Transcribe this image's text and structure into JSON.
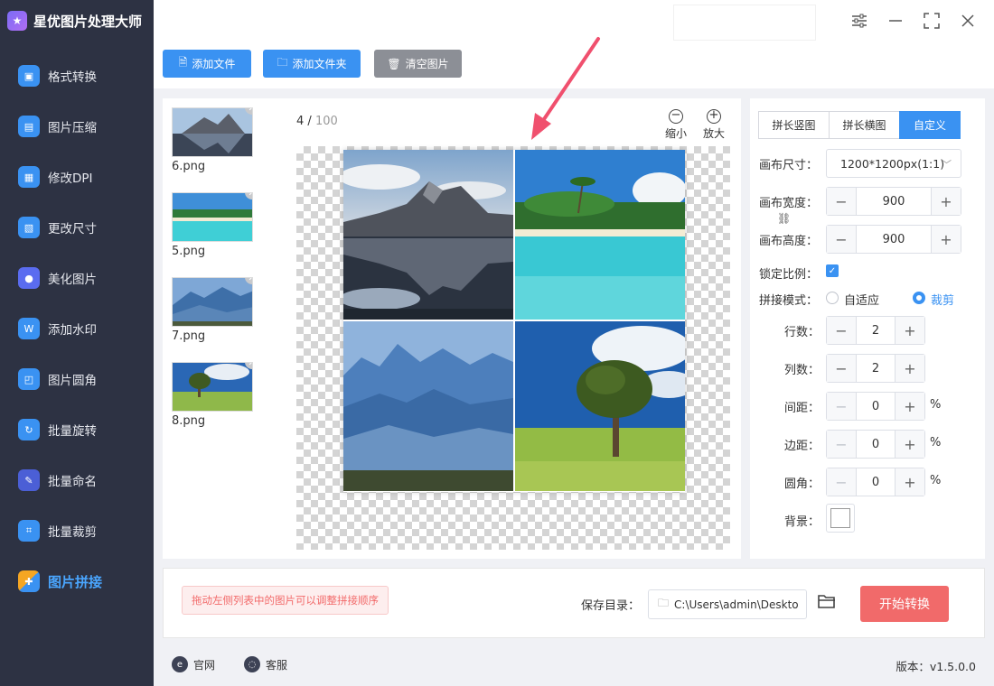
{
  "app": {
    "title": "星优图片处理大师",
    "logo_text": "★"
  },
  "sidebar": {
    "items": [
      {
        "label": "格式转换",
        "icon": "image-convert-icon",
        "color": "#3a92f2"
      },
      {
        "label": "图片压缩",
        "icon": "image-compress-icon",
        "color": "#3a92f2"
      },
      {
        "label": "修改DPI",
        "icon": "dpi-icon",
        "color": "#3a92f2"
      },
      {
        "label": "更改尺寸",
        "icon": "resize-icon",
        "color": "#3a92f2"
      },
      {
        "label": "美化图片",
        "icon": "beautify-icon",
        "color": "#5a6cf0"
      },
      {
        "label": "添加水印",
        "icon": "watermark-icon",
        "color": "#3a92f2"
      },
      {
        "label": "图片圆角",
        "icon": "round-corner-icon",
        "color": "#3a92f2"
      },
      {
        "label": "批量旋转",
        "icon": "rotate-icon",
        "color": "#3a92f2"
      },
      {
        "label": "批量命名",
        "icon": "rename-icon",
        "color": "#4b5fd6"
      },
      {
        "label": "批量裁剪",
        "icon": "crop-icon",
        "color": "#3a92f2"
      },
      {
        "label": "图片拼接",
        "icon": "puzzle-icon",
        "color": "#f5a623"
      }
    ],
    "active_index": 10
  },
  "toolbar": {
    "add_file": "添加文件",
    "add_folder": "添加文件夹",
    "clear": "清空图片"
  },
  "files": [
    {
      "name": "6.png",
      "scene": "lake"
    },
    {
      "name": "5.png",
      "scene": "beach"
    },
    {
      "name": "7.png",
      "scene": "mountains"
    },
    {
      "name": "8.png",
      "scene": "tree"
    }
  ],
  "preview": {
    "count": "4",
    "separator": " / ",
    "total": "100",
    "zoom_out": "缩小",
    "zoom_in": "放大"
  },
  "settings": {
    "tabs": [
      "拼长竖图",
      "拼长横图",
      "自定义"
    ],
    "active_tab": 2,
    "canvas_size_label": "画布尺寸：",
    "canvas_size_value": "1200*1200px(1:1)",
    "canvas_width_label": "画布宽度：",
    "canvas_width": "900",
    "canvas_height_label": "画布高度：",
    "canvas_height": "900",
    "lock_ratio_label": "锁定比例：",
    "lock_ratio": true,
    "mode_label": "拼接模式：",
    "mode_options": [
      "自适应",
      "裁剪"
    ],
    "mode_selected": "裁剪",
    "rows_label": "行数：",
    "rows": "2",
    "cols_label": "列数：",
    "cols": "2",
    "spacing_label": "间距：",
    "spacing": "0",
    "margin_label": "边距：",
    "margin": "0",
    "radius_label": "圆角：",
    "radius": "0",
    "percent": "%",
    "bg_label": "背景：",
    "bg_color": "#ffffff"
  },
  "bottom": {
    "hint": "拖动左侧列表中的图片可以调整拼接顺序",
    "save_label": "保存目录：",
    "save_path": "C:\\Users\\admin\\Deskto",
    "start": "开始转换"
  },
  "footer": {
    "website": "官网",
    "support": "客服",
    "version": "版本：v1.5.0.0"
  },
  "colors": {
    "accent": "#3a92f2",
    "danger": "#f16a6a",
    "sidebar": "#2d3243"
  }
}
